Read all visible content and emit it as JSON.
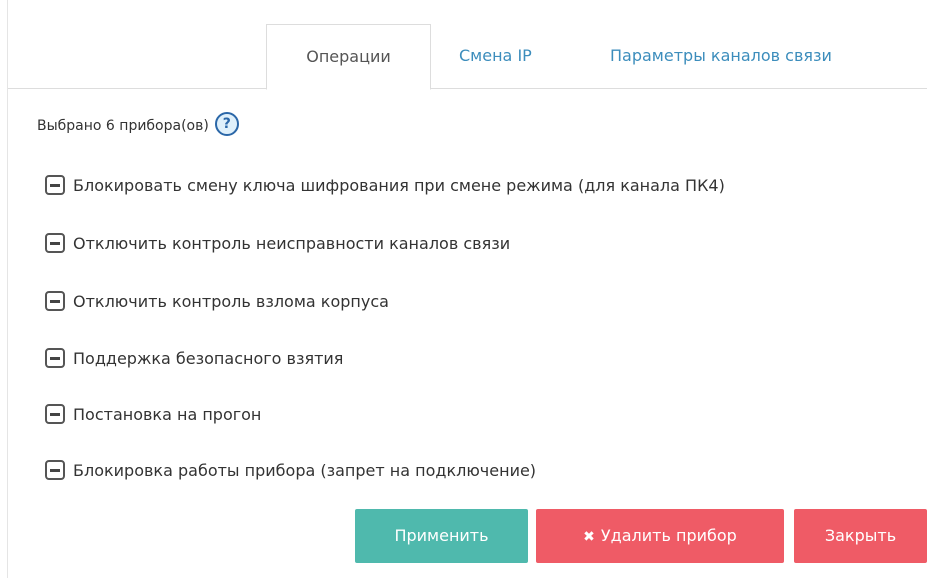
{
  "tabs": {
    "operations": "Операции",
    "change_ip": "Смена IP",
    "channels": "Параметры каналов связи"
  },
  "selection": {
    "text": "Выбрано 6 прибора(ов)",
    "help_glyph": "?"
  },
  "options": [
    {
      "label": "Блокировать смену ключа шифрования при смене режима (для канала ПК4)",
      "state": "indeterminate"
    },
    {
      "label": "Отключить контроль неисправности каналов связи",
      "state": "indeterminate"
    },
    {
      "label": "Отключить контроль взлома корпуса",
      "state": "indeterminate"
    },
    {
      "label": "Поддержка безопасного взятия",
      "state": "indeterminate"
    },
    {
      "label": "Постановка на прогон",
      "state": "indeterminate"
    },
    {
      "label": "Блокировка работы прибора (запрет на подключение)",
      "state": "indeterminate"
    }
  ],
  "buttons": {
    "apply": "Применить",
    "delete_icon": "✖",
    "delete": "Удалить прибор",
    "close": "Закрыть"
  },
  "colors": {
    "apply": "#4fb9ad",
    "danger": "#ef5b66",
    "link": "#3c8dbc",
    "help": "#2b67a8"
  }
}
